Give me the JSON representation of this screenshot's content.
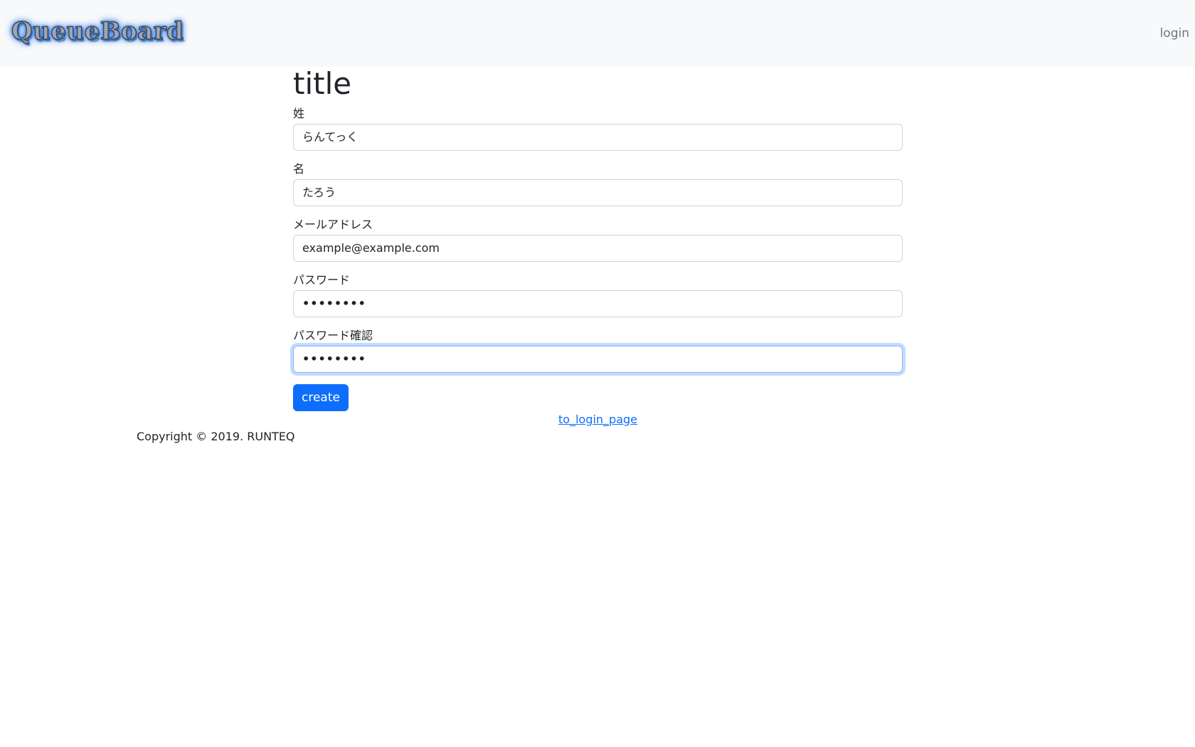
{
  "navbar": {
    "brand": "QueueBoard",
    "login_link": "login"
  },
  "form": {
    "title": "title",
    "fields": [
      {
        "label": "姓",
        "value": "らんてっく",
        "type": "text"
      },
      {
        "label": "名",
        "value": "たろう",
        "type": "text"
      },
      {
        "label": "メールアドレス",
        "value": "example@example.com",
        "type": "email"
      },
      {
        "label": "パスワード",
        "value": "••••••••",
        "type": "password"
      },
      {
        "label": "パスワード確認",
        "value": "••••••••",
        "type": "password",
        "focused": true
      }
    ],
    "submit_label": "create",
    "login_page_link": "to_login_page"
  },
  "footer": {
    "copyright": "Copyright © 2019. RUNTEQ"
  },
  "colors": {
    "primary": "#0d6efd",
    "navbar_bg": "#f8f9fa",
    "focus_border": "#86b7fe"
  }
}
